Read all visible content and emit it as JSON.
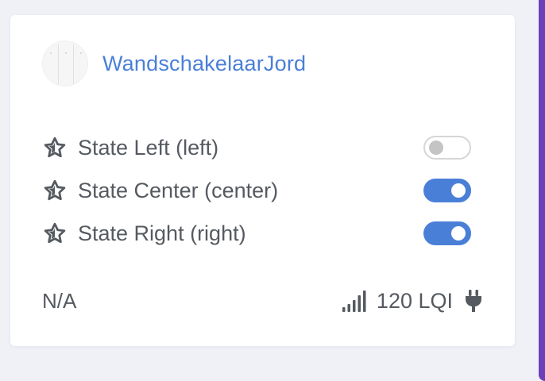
{
  "device": {
    "name": "WandschakelaarJord",
    "image_icon": "wall-switch-icon"
  },
  "states": [
    {
      "label": "State Left (left)",
      "on": false,
      "icon": "star-icon"
    },
    {
      "label": "State Center (center)",
      "on": true,
      "icon": "star-icon"
    },
    {
      "label": "State Right (right)",
      "on": true,
      "icon": "star-icon"
    }
  ],
  "footer": {
    "last_seen": "N/A",
    "lqi": "120 LQI",
    "signal_icon": "signal-bars-icon",
    "power_icon": "plug-icon"
  },
  "colors": {
    "accent": "#4a7fd8",
    "text": "#555a60",
    "edge": "#6b3fb8"
  }
}
